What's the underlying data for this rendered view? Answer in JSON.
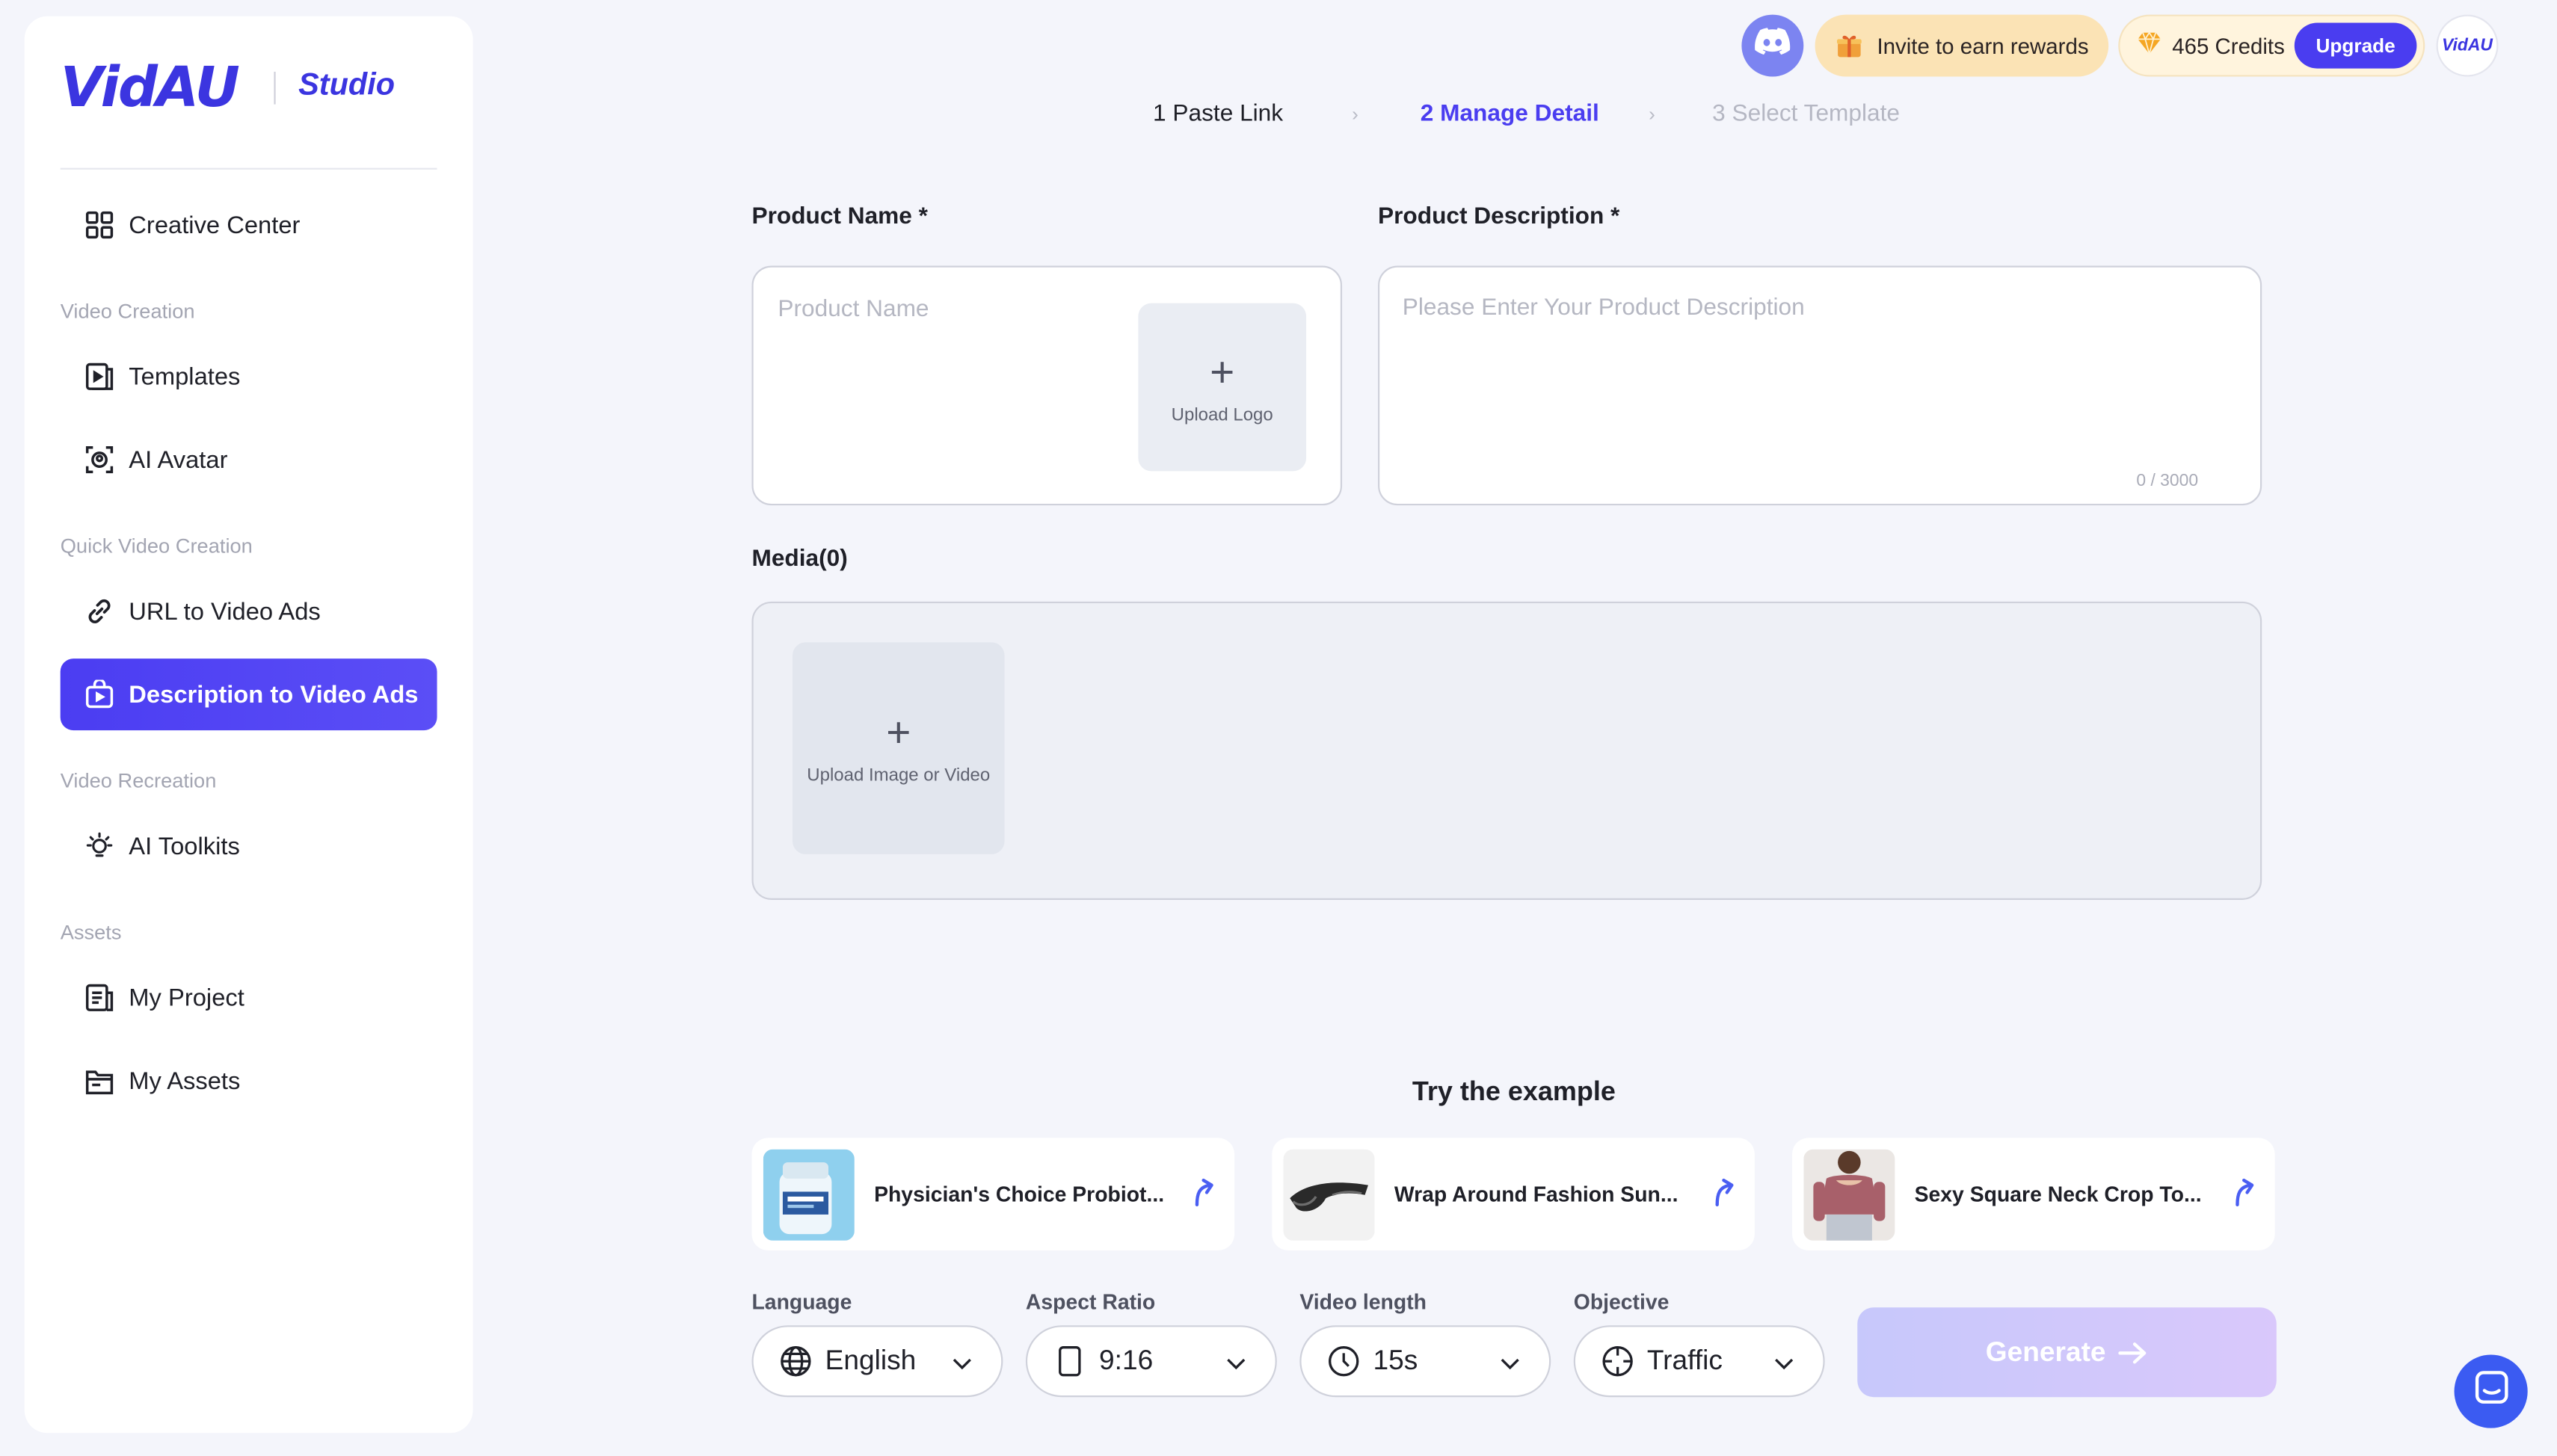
{
  "brand": {
    "logo": "VidAU",
    "product": "Studio"
  },
  "sidebar": {
    "creative_center": "Creative Center",
    "sections": {
      "video_creation": "Video Creation",
      "quick_video_creation": "Quick Video Creation",
      "video_recreation": "Video Recreation",
      "assets": "Assets"
    },
    "items": {
      "templates": "Templates",
      "ai_avatar": "AI Avatar",
      "url_to_video": "URL to Video Ads",
      "description_to_video": "Description to Video Ads",
      "ai_toolkits": "AI Toolkits",
      "my_project": "My Project",
      "my_assets": "My Assets"
    },
    "active": "description_to_video"
  },
  "topbar": {
    "invite": "Invite to earn rewards",
    "credits": "465 Credits",
    "upgrade": "Upgrade",
    "avatar_text": "VidAU"
  },
  "steps": {
    "s1": "1 Paste Link",
    "s2": "2 Manage Detail",
    "s3": "3 Select Template",
    "current": 2
  },
  "form": {
    "product_name_label": "Product Name *",
    "product_name_placeholder": "Product Name",
    "upload_logo": "Upload Logo",
    "description_label": "Product Description *",
    "description_placeholder": "Please Enter Your Product Description",
    "description_counter": "0 / 3000",
    "media_label": "Media(0)",
    "upload_media": "Upload Image or Video"
  },
  "examples": {
    "title": "Try the example",
    "items": [
      {
        "title": "Physician's Choice Probiot..."
      },
      {
        "title": "Wrap Around Fashion Sun..."
      },
      {
        "title": "Sexy Square Neck Crop To..."
      }
    ]
  },
  "controls": {
    "language": {
      "label": "Language",
      "value": "English"
    },
    "aspect_ratio": {
      "label": "Aspect Ratio",
      "value": "9:16"
    },
    "video_length": {
      "label": "Video length",
      "value": "15s"
    },
    "objective": {
      "label": "Objective",
      "value": "Traffic"
    },
    "generate": "Generate"
  },
  "colors": {
    "accent": "#4a3df0",
    "background": "#f4f5fb",
    "invite_bg": "#fbe3b5",
    "generate_disabled": "#c7c8fb"
  },
  "icons": {
    "discord": "discord-icon",
    "chat": "chat-icon",
    "gem": "gem-icon"
  }
}
